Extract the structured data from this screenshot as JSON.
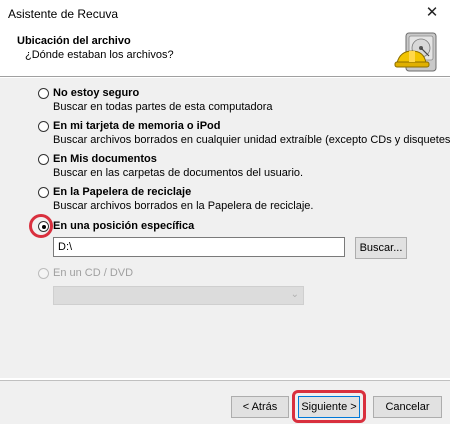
{
  "window": {
    "title": "Asistente de Recuva",
    "close_glyph": "✕"
  },
  "header": {
    "title": "Ubicación del archivo",
    "subtitle": "¿Dónde estaban los archivos?",
    "icon": "recuva-hard-hat-drive-icon"
  },
  "options": [
    {
      "label": "No estoy seguro",
      "description": "Buscar en todas partes de esta computadora",
      "selected": false,
      "enabled": true
    },
    {
      "label": "En mi tarjeta de memoria o iPod",
      "description": "Buscar archivos borrados en cualquier unidad extraíble (excepto CDs y disquetes).",
      "selected": false,
      "enabled": true
    },
    {
      "label": "En Mis documentos",
      "description": "Buscar en las carpetas de documentos del usuario.",
      "selected": false,
      "enabled": true
    },
    {
      "label": "En la Papelera de reciclaje",
      "description": "Buscar archivos borrados en la Papelera de reciclaje.",
      "selected": false,
      "enabled": true
    },
    {
      "label": "En una posición específica",
      "description": "",
      "selected": true,
      "enabled": true
    },
    {
      "label": "En un CD / DVD",
      "description": "",
      "selected": false,
      "enabled": false
    }
  ],
  "location": {
    "path_value": "D:\\",
    "browse_label": "Buscar..."
  },
  "cd_combo": {
    "selected": "",
    "arrow": "⌄"
  },
  "footer": {
    "back_label": "< Atrás",
    "next_label": "Siguiente >",
    "cancel_label": "Cancelar"
  },
  "colors": {
    "highlight": "#d9303e",
    "dialog_bg": "#f0f0f0",
    "button_bg": "#e1e1e1",
    "default_button_border": "#0078d7"
  }
}
